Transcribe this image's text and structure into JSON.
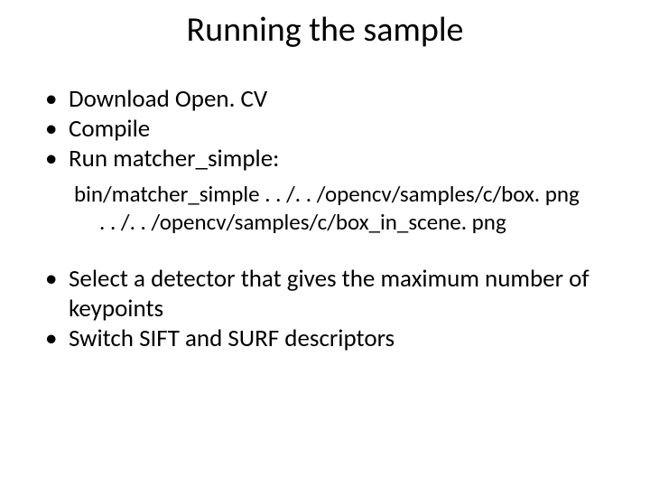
{
  "title": "Running the sample",
  "bullets": {
    "b1": "Download Open. CV",
    "b2": "Compile",
    "b3": "Run matcher_simple:",
    "b4": "Select a detector that gives the maximum number of keypoints",
    "b5": "Switch SIFT and SURF descriptors"
  },
  "command": {
    "line1": "bin/matcher_simple . . /. . /opencv/samples/c/box. png",
    "line2": ". . /. . /opencv/samples/c/box_in_scene. png"
  }
}
